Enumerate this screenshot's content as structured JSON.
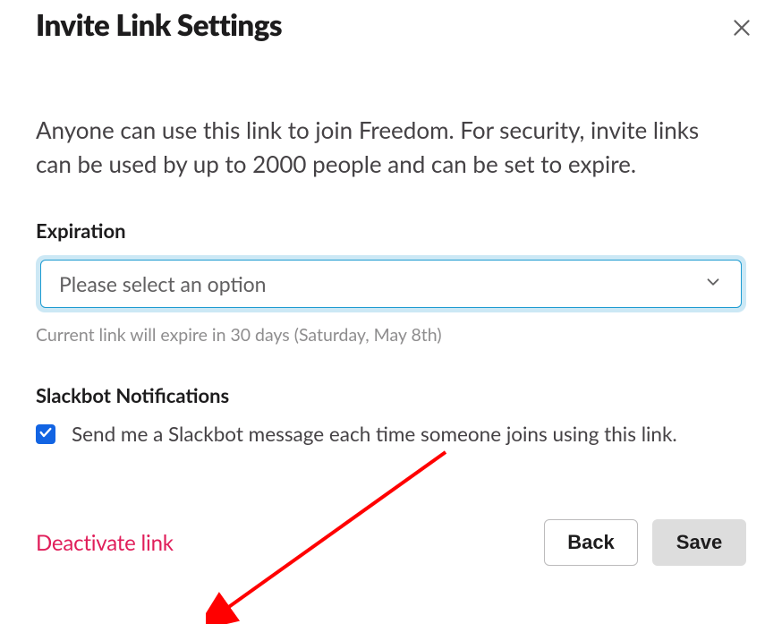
{
  "modal": {
    "title": "Invite Link Settings",
    "description": "Anyone can use this link to join Freedom. For security, invite links can be used by up to 2000 people and can be set to expire.",
    "close_label": "Close"
  },
  "expiration": {
    "label": "Expiration",
    "placeholder": "Please select an option",
    "helper": "Current link will expire in 30 days (Saturday, May 8th)"
  },
  "notifications": {
    "label": "Slackbot Notifications",
    "checkbox_label": "Send me a Slackbot message each time someone joins using this link.",
    "checked": true
  },
  "footer": {
    "deactivate_label": "Deactivate link",
    "back_label": "Back",
    "save_label": "Save"
  },
  "colors": {
    "accent_blue": "#1264e3",
    "border_blue": "#1d9bd1",
    "focus_ring": "#cce8f5",
    "danger": "#e01e5a",
    "arrow": "#ff0000"
  }
}
